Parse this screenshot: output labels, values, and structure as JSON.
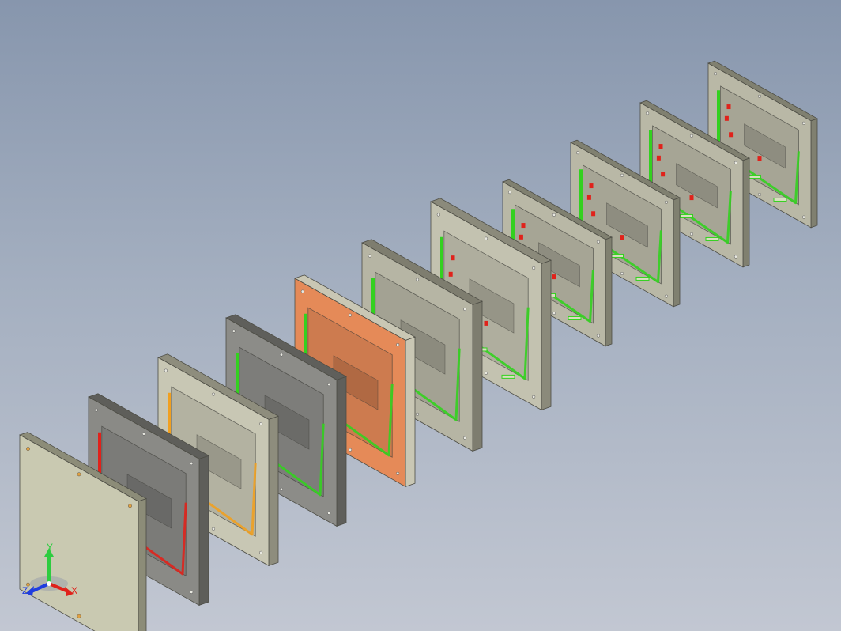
{
  "scene": {
    "background_top": "#8796ad",
    "background_bottom": "#c2c7d2",
    "plates": [
      {
        "id": "base-plate",
        "kind": "solid",
        "face": "#c9c9b1",
        "side": "#8c8c78",
        "accent": null
      },
      {
        "id": "mold-plate-1",
        "kind": "cavity",
        "face": "#8a8a86",
        "side": "#5e5e5a",
        "accent": "#e0221b"
      },
      {
        "id": "mold-plate-2",
        "kind": "frame",
        "face": "#c8c7b4",
        "side": "#8e8d7d",
        "accent": "#f0a020"
      },
      {
        "id": "mold-plate-3",
        "kind": "cavity",
        "face": "#8c8c88",
        "side": "#5f5f5b",
        "accent": "#33d11f"
      },
      {
        "id": "mold-plate-4",
        "kind": "core",
        "face": "#e58a58",
        "side": "#c9c7b4",
        "accent": "#33d11f"
      },
      {
        "id": "mold-plate-5",
        "kind": "core",
        "face": "#b6b5a4",
        "side": "#7e7d6f",
        "accent": "#33d11f"
      },
      {
        "id": "mold-plate-6",
        "kind": "housing",
        "face": "#c3c2b0",
        "side": "#8b8a7b",
        "accent": "#33d11f"
      },
      {
        "id": "housing-7",
        "kind": "housing",
        "face": "#b9b8a6",
        "side": "#808070",
        "accent": "#33d11f"
      },
      {
        "id": "housing-8",
        "kind": "housing",
        "face": "#b9b8a6",
        "side": "#808070",
        "accent": "#33d11f"
      },
      {
        "id": "housing-9",
        "kind": "housing",
        "face": "#b9b8a6",
        "side": "#808070",
        "accent": "#33d11f"
      },
      {
        "id": "housing-10",
        "kind": "housing",
        "face": "#b9b8a6",
        "side": "#808070",
        "accent": "#33d11f"
      }
    ]
  },
  "triad": {
    "x_label": "X",
    "y_label": "Y",
    "z_label": "Z",
    "x_color": "#e0221b",
    "y_color": "#2ecc40",
    "z_color": "#1f3de0"
  }
}
